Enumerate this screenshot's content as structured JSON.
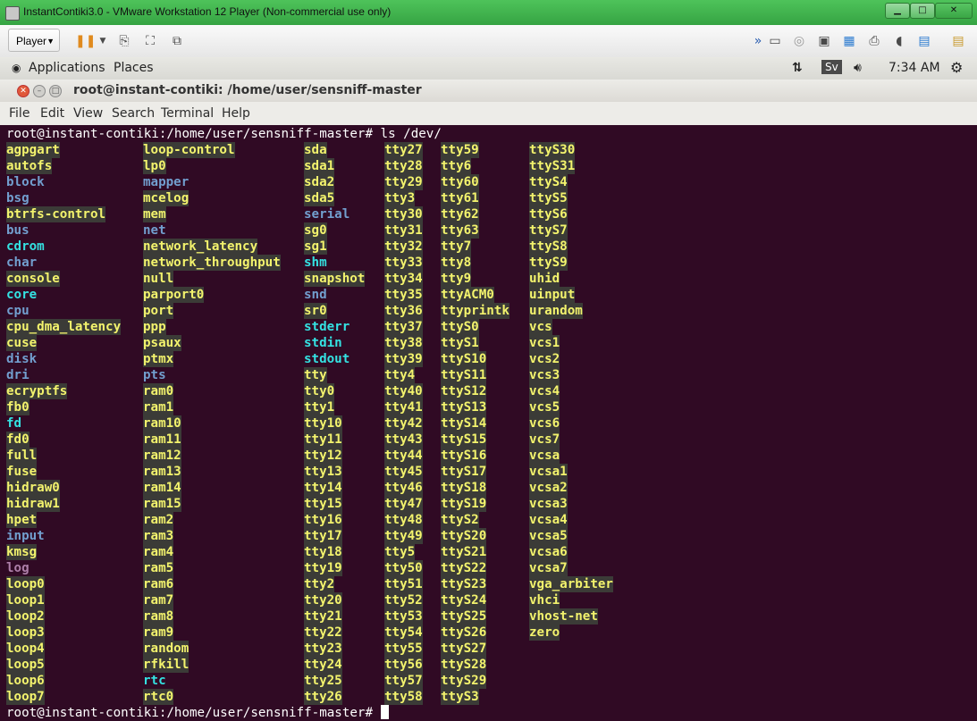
{
  "window": {
    "title": "InstantContiki3.0 - VMware Workstation 12 Player (Non-commercial use only)",
    "minimize_label": "▁",
    "maximize_label": "□",
    "close_label": "✕"
  },
  "vmware_toolbar": {
    "player_label": "Player"
  },
  "ubuntu_panel": {
    "applications_label": "Applications",
    "places_label": "Places",
    "keyboard_layout": "Sv",
    "time": "7:34 AM"
  },
  "terminal_window": {
    "title": "root@instant-contiki: /home/user/sensniff-master",
    "menu": [
      "File",
      "Edit",
      "View",
      "Search",
      "Terminal",
      "Help"
    ]
  },
  "terminal": {
    "prompt": "root@instant-contiki:/home/user/sensniff-master# ",
    "command": "ls /dev/",
    "final_prompt": "root@instant-contiki:/home/user/sensniff-master#",
    "columns": [
      [
        [
          "agpgart",
          "dev"
        ],
        [
          "autofs",
          "dev"
        ],
        [
          "block",
          "dir"
        ],
        [
          "bsg",
          "dir"
        ],
        [
          "btrfs-control",
          "dev"
        ],
        [
          "bus",
          "dir"
        ],
        [
          "cdrom",
          "lnk"
        ],
        [
          "char",
          "dir"
        ],
        [
          "console",
          "dev"
        ],
        [
          "core",
          "lnk"
        ],
        [
          "cpu",
          "dir"
        ],
        [
          "cpu_dma_latency",
          "dev"
        ],
        [
          "cuse",
          "dev"
        ],
        [
          "disk",
          "dir"
        ],
        [
          "dri",
          "dir"
        ],
        [
          "ecryptfs",
          "dev"
        ],
        [
          "fb0",
          "dev"
        ],
        [
          "fd",
          "lnk"
        ],
        [
          "fd0",
          "dev"
        ],
        [
          "full",
          "dev"
        ],
        [
          "fuse",
          "dev"
        ],
        [
          "hidraw0",
          "dev"
        ],
        [
          "hidraw1",
          "dev"
        ],
        [
          "hpet",
          "dev"
        ],
        [
          "input",
          "dir"
        ],
        [
          "kmsg",
          "dev"
        ],
        [
          "log",
          "sock"
        ],
        [
          "loop0",
          "dev"
        ],
        [
          "loop1",
          "dev"
        ],
        [
          "loop2",
          "dev"
        ],
        [
          "loop3",
          "dev"
        ],
        [
          "loop4",
          "dev"
        ],
        [
          "loop5",
          "dev"
        ],
        [
          "loop6",
          "dev"
        ],
        [
          "loop7",
          "dev"
        ]
      ],
      [
        [
          "loop-control",
          "dev"
        ],
        [
          "lp0",
          "dev"
        ],
        [
          "mapper",
          "dir"
        ],
        [
          "mcelog",
          "dev"
        ],
        [
          "mem",
          "dev"
        ],
        [
          "net",
          "dir"
        ],
        [
          "network_latency",
          "dev"
        ],
        [
          "network_throughput",
          "dev"
        ],
        [
          "null",
          "dev"
        ],
        [
          "parport0",
          "dev"
        ],
        [
          "port",
          "dev"
        ],
        [
          "ppp",
          "dev"
        ],
        [
          "psaux",
          "dev"
        ],
        [
          "ptmx",
          "dev"
        ],
        [
          "pts",
          "dir"
        ],
        [
          "ram0",
          "dev"
        ],
        [
          "ram1",
          "dev"
        ],
        [
          "ram10",
          "dev"
        ],
        [
          "ram11",
          "dev"
        ],
        [
          "ram12",
          "dev"
        ],
        [
          "ram13",
          "dev"
        ],
        [
          "ram14",
          "dev"
        ],
        [
          "ram15",
          "dev"
        ],
        [
          "ram2",
          "dev"
        ],
        [
          "ram3",
          "dev"
        ],
        [
          "ram4",
          "dev"
        ],
        [
          "ram5",
          "dev"
        ],
        [
          "ram6",
          "dev"
        ],
        [
          "ram7",
          "dev"
        ],
        [
          "ram8",
          "dev"
        ],
        [
          "ram9",
          "dev"
        ],
        [
          "random",
          "dev"
        ],
        [
          "rfkill",
          "dev"
        ],
        [
          "rtc",
          "lnk"
        ],
        [
          "rtc0",
          "dev"
        ]
      ],
      [
        [
          "sda",
          "dev"
        ],
        [
          "sda1",
          "dev"
        ],
        [
          "sda2",
          "dev"
        ],
        [
          "sda5",
          "dev"
        ],
        [
          "serial",
          "dir"
        ],
        [
          "sg0",
          "dev"
        ],
        [
          "sg1",
          "dev"
        ],
        [
          "shm",
          "lnk"
        ],
        [
          "snapshot",
          "dev"
        ],
        [
          "snd",
          "dir"
        ],
        [
          "sr0",
          "dev"
        ],
        [
          "stderr",
          "lnk"
        ],
        [
          "stdin",
          "lnk"
        ],
        [
          "stdout",
          "lnk"
        ],
        [
          "tty",
          "dev"
        ],
        [
          "tty0",
          "dev"
        ],
        [
          "tty1",
          "dev"
        ],
        [
          "tty10",
          "dev"
        ],
        [
          "tty11",
          "dev"
        ],
        [
          "tty12",
          "dev"
        ],
        [
          "tty13",
          "dev"
        ],
        [
          "tty14",
          "dev"
        ],
        [
          "tty15",
          "dev"
        ],
        [
          "tty16",
          "dev"
        ],
        [
          "tty17",
          "dev"
        ],
        [
          "tty18",
          "dev"
        ],
        [
          "tty19",
          "dev"
        ],
        [
          "tty2",
          "dev"
        ],
        [
          "tty20",
          "dev"
        ],
        [
          "tty21",
          "dev"
        ],
        [
          "tty22",
          "dev"
        ],
        [
          "tty23",
          "dev"
        ],
        [
          "tty24",
          "dev"
        ],
        [
          "tty25",
          "dev"
        ],
        [
          "tty26",
          "dev"
        ]
      ],
      [
        [
          "tty27",
          "dev"
        ],
        [
          "tty28",
          "dev"
        ],
        [
          "tty29",
          "dev"
        ],
        [
          "tty3",
          "dev"
        ],
        [
          "tty30",
          "dev"
        ],
        [
          "tty31",
          "dev"
        ],
        [
          "tty32",
          "dev"
        ],
        [
          "tty33",
          "dev"
        ],
        [
          "tty34",
          "dev"
        ],
        [
          "tty35",
          "dev"
        ],
        [
          "tty36",
          "dev"
        ],
        [
          "tty37",
          "dev"
        ],
        [
          "tty38",
          "dev"
        ],
        [
          "tty39",
          "dev"
        ],
        [
          "tty4",
          "dev"
        ],
        [
          "tty40",
          "dev"
        ],
        [
          "tty41",
          "dev"
        ],
        [
          "tty42",
          "dev"
        ],
        [
          "tty43",
          "dev"
        ],
        [
          "tty44",
          "dev"
        ],
        [
          "tty45",
          "dev"
        ],
        [
          "tty46",
          "dev"
        ],
        [
          "tty47",
          "dev"
        ],
        [
          "tty48",
          "dev"
        ],
        [
          "tty49",
          "dev"
        ],
        [
          "tty5",
          "dev"
        ],
        [
          "tty50",
          "dev"
        ],
        [
          "tty51",
          "dev"
        ],
        [
          "tty52",
          "dev"
        ],
        [
          "tty53",
          "dev"
        ],
        [
          "tty54",
          "dev"
        ],
        [
          "tty55",
          "dev"
        ],
        [
          "tty56",
          "dev"
        ],
        [
          "tty57",
          "dev"
        ],
        [
          "tty58",
          "dev"
        ]
      ],
      [
        [
          "tty59",
          "dev"
        ],
        [
          "tty6",
          "dev"
        ],
        [
          "tty60",
          "dev"
        ],
        [
          "tty61",
          "dev"
        ],
        [
          "tty62",
          "dev"
        ],
        [
          "tty63",
          "dev"
        ],
        [
          "tty7",
          "dev"
        ],
        [
          "tty8",
          "dev"
        ],
        [
          "tty9",
          "dev"
        ],
        [
          "ttyACM0",
          "dev"
        ],
        [
          "ttyprintk",
          "dev"
        ],
        [
          "ttyS0",
          "dev"
        ],
        [
          "ttyS1",
          "dev"
        ],
        [
          "ttyS10",
          "dev"
        ],
        [
          "ttyS11",
          "dev"
        ],
        [
          "ttyS12",
          "dev"
        ],
        [
          "ttyS13",
          "dev"
        ],
        [
          "ttyS14",
          "dev"
        ],
        [
          "ttyS15",
          "dev"
        ],
        [
          "ttyS16",
          "dev"
        ],
        [
          "ttyS17",
          "dev"
        ],
        [
          "ttyS18",
          "dev"
        ],
        [
          "ttyS19",
          "dev"
        ],
        [
          "ttyS2",
          "dev"
        ],
        [
          "ttyS20",
          "dev"
        ],
        [
          "ttyS21",
          "dev"
        ],
        [
          "ttyS22",
          "dev"
        ],
        [
          "ttyS23",
          "dev"
        ],
        [
          "ttyS24",
          "dev"
        ],
        [
          "ttyS25",
          "dev"
        ],
        [
          "ttyS26",
          "dev"
        ],
        [
          "ttyS27",
          "dev"
        ],
        [
          "ttyS28",
          "dev"
        ],
        [
          "ttyS29",
          "dev"
        ],
        [
          "ttyS3",
          "dev"
        ]
      ],
      [
        [
          "ttyS30",
          "dev"
        ],
        [
          "ttyS31",
          "dev"
        ],
        [
          "ttyS4",
          "dev"
        ],
        [
          "ttyS5",
          "dev"
        ],
        [
          "ttyS6",
          "dev"
        ],
        [
          "ttyS7",
          "dev"
        ],
        [
          "ttyS8",
          "dev"
        ],
        [
          "ttyS9",
          "dev"
        ],
        [
          "uhid",
          "dev"
        ],
        [
          "uinput",
          "dev"
        ],
        [
          "urandom",
          "dev"
        ],
        [
          "vcs",
          "dev"
        ],
        [
          "vcs1",
          "dev"
        ],
        [
          "vcs2",
          "dev"
        ],
        [
          "vcs3",
          "dev"
        ],
        [
          "vcs4",
          "dev"
        ],
        [
          "vcs5",
          "dev"
        ],
        [
          "vcs6",
          "dev"
        ],
        [
          "vcs7",
          "dev"
        ],
        [
          "vcsa",
          "dev"
        ],
        [
          "vcsa1",
          "dev"
        ],
        [
          "vcsa2",
          "dev"
        ],
        [
          "vcsa3",
          "dev"
        ],
        [
          "vcsa4",
          "dev"
        ],
        [
          "vcsa5",
          "dev"
        ],
        [
          "vcsa6",
          "dev"
        ],
        [
          "vcsa7",
          "dev"
        ],
        [
          "vga_arbiter",
          "dev"
        ],
        [
          "vhci",
          "dev"
        ],
        [
          "vhost-net",
          "dev"
        ],
        [
          "zero",
          "dev"
        ]
      ]
    ]
  }
}
